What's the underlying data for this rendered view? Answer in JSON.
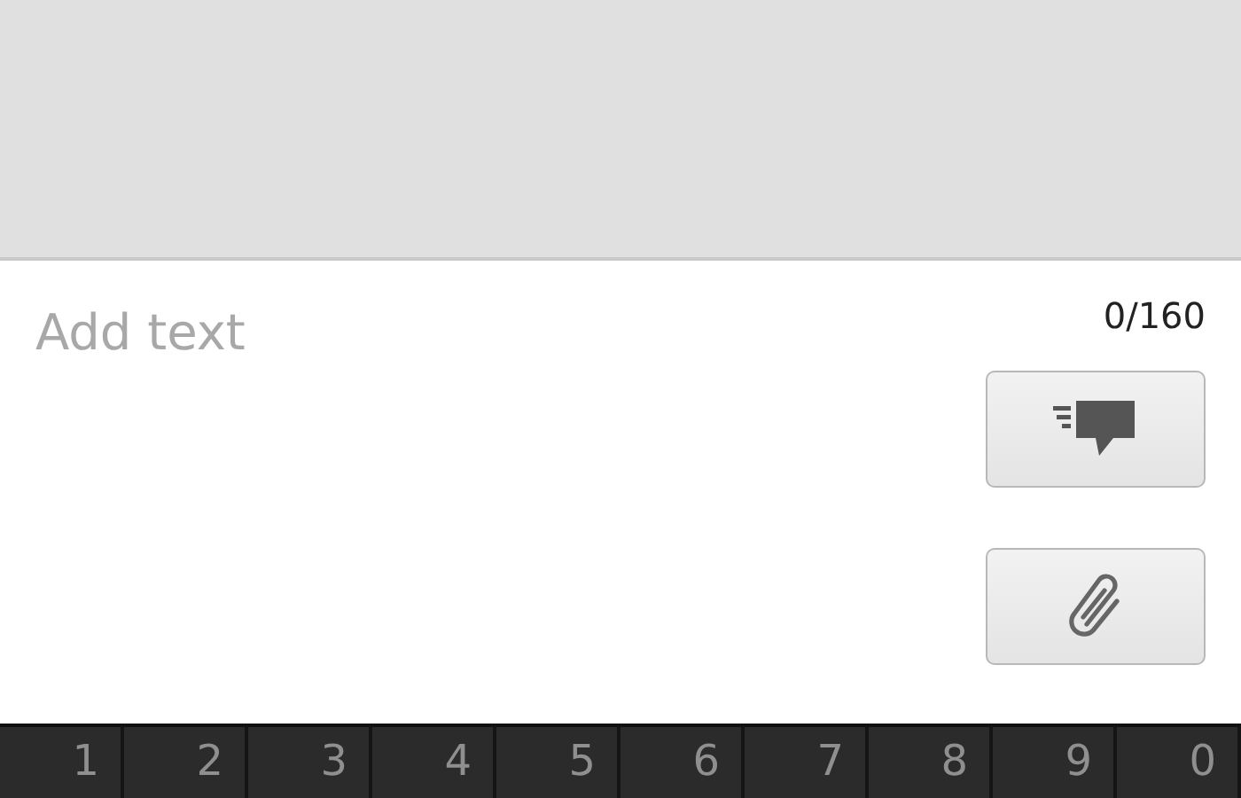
{
  "compose": {
    "placeholder": "Add text",
    "counter": "0/160"
  },
  "keyboard": {
    "keys": [
      "1",
      "2",
      "3",
      "4",
      "5",
      "6",
      "7",
      "8",
      "9",
      "0"
    ]
  }
}
